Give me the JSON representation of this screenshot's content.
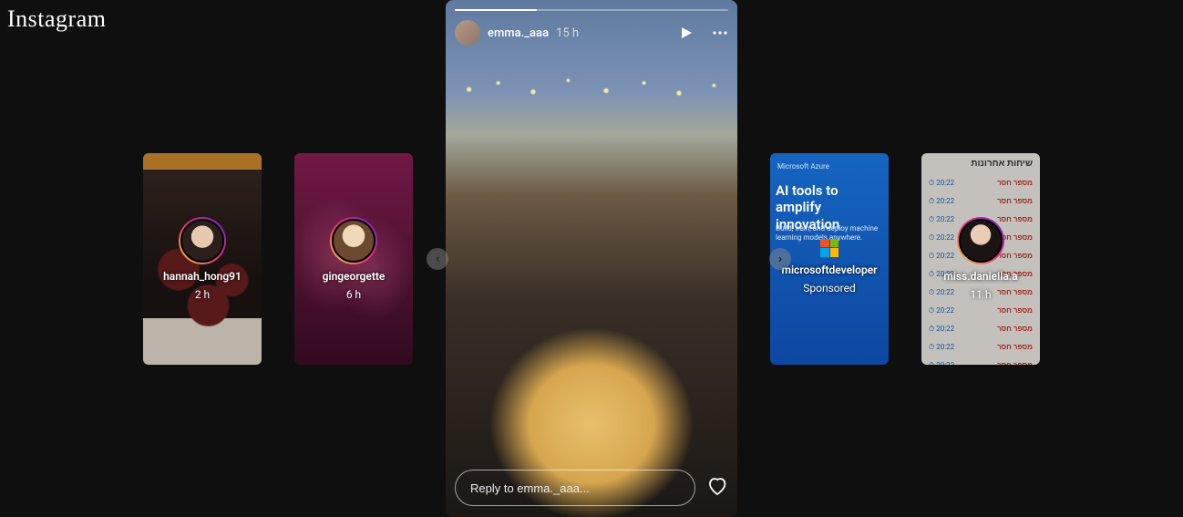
{
  "app": {
    "logo_text": "Instagram"
  },
  "nav": {
    "prev_glyph": "‹",
    "next_glyph": "›"
  },
  "main_story": {
    "username": "emma._aaa",
    "timestamp": "15 h",
    "reply_placeholder": "Reply to emma._aaa..."
  },
  "tiles": {
    "left": [
      {
        "username": "hannah_hong91",
        "time": "2 h"
      },
      {
        "username": "gingeorgette",
        "time": "6 h"
      }
    ],
    "right": [
      {
        "username": "microsoftdeveloper",
        "time": "Sponsored",
        "brand": "Microsoft Azure",
        "headline": "AI tools to amplify innovation",
        "sub": "Build, train, and deploy machine learning models anywhere."
      },
      {
        "username": "miss.daniella.a",
        "time": "11 h",
        "chat_title": "שיחות אחרונות",
        "chat_left": "⏱ 20:22",
        "chat_right": "מספר חסר"
      }
    ]
  }
}
